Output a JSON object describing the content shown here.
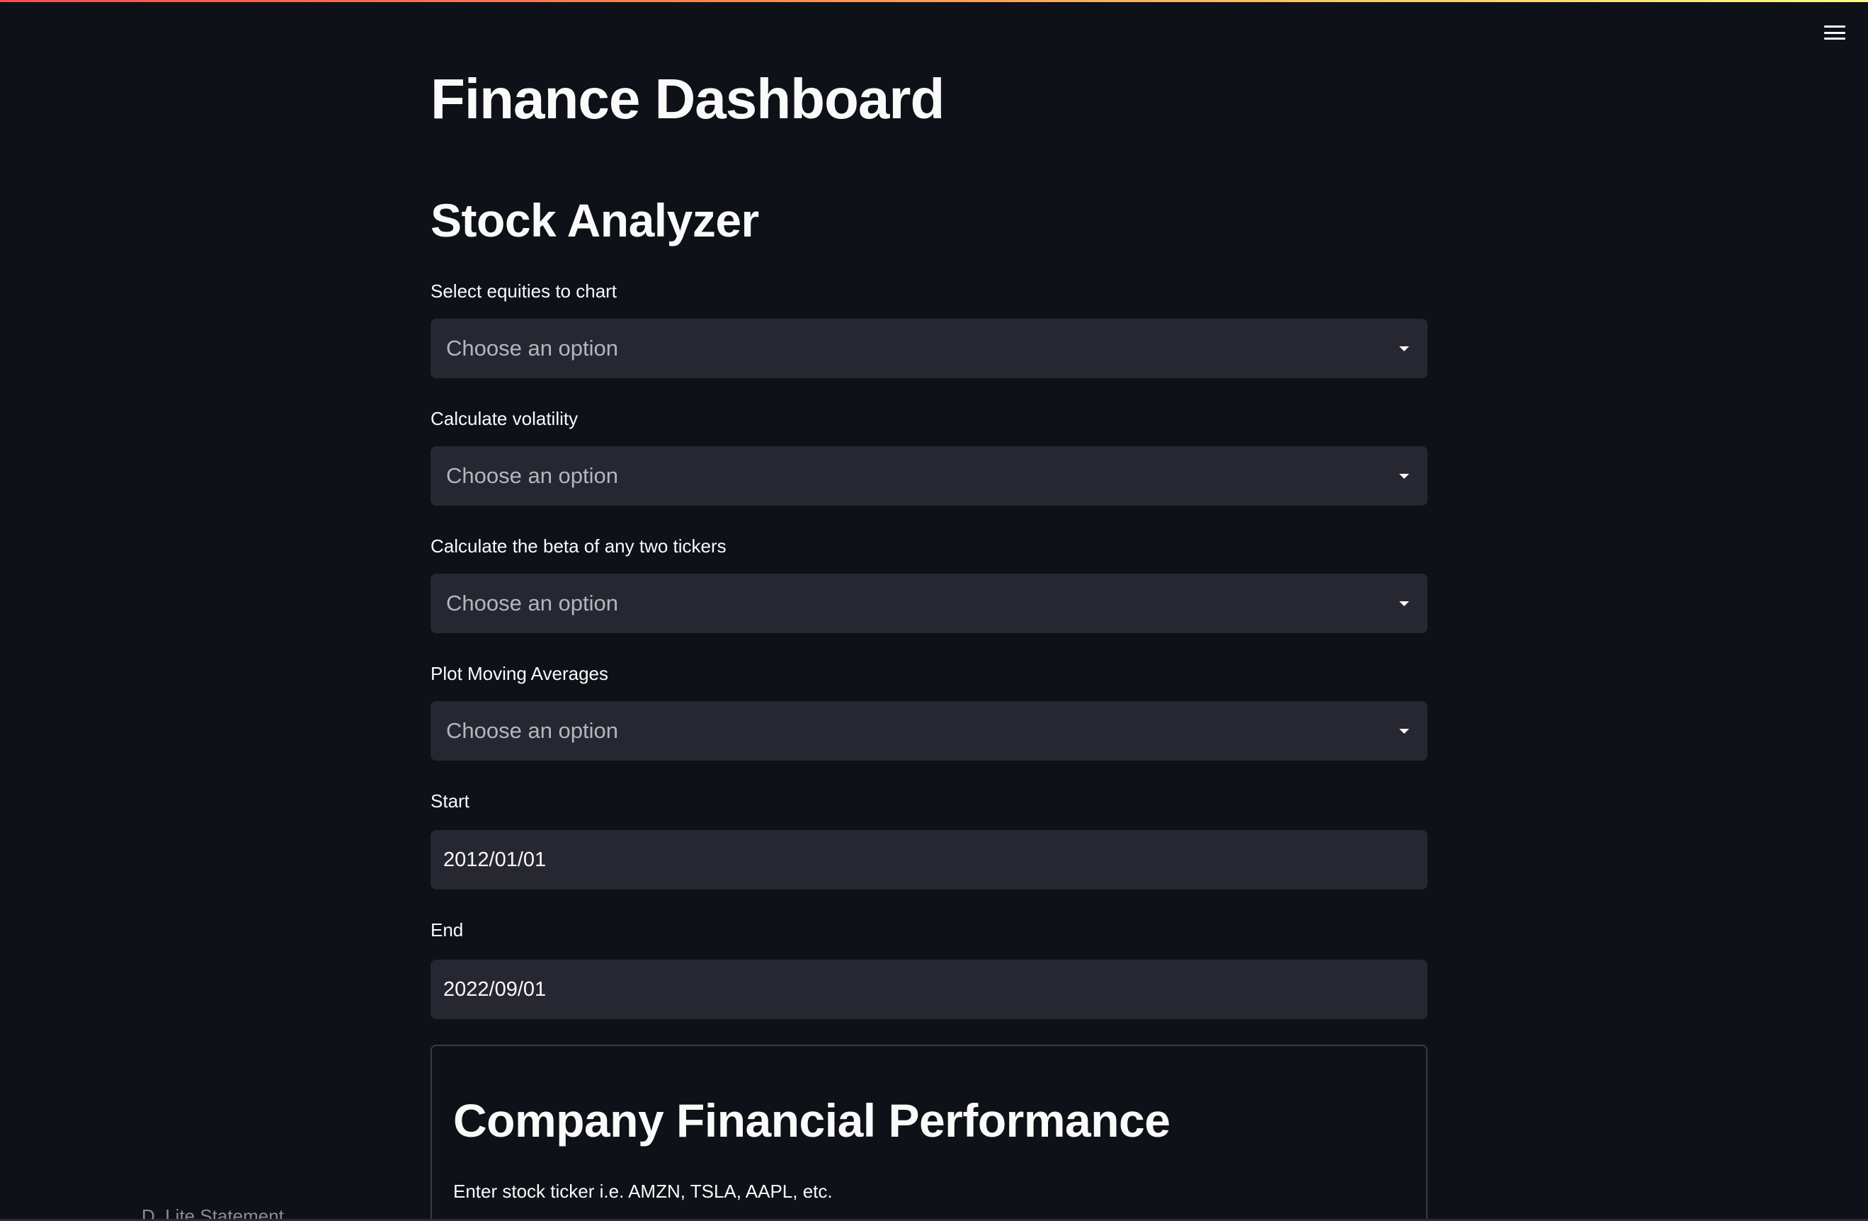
{
  "header": {
    "menu_icon": "hamburger-menu-icon",
    "accent_gradient": [
      "#ff4b4b",
      "#fffd80"
    ]
  },
  "main": {
    "title": "Finance Dashboard",
    "section_title": "Stock Analyzer",
    "fields": [
      {
        "label": "Select equities to chart",
        "placeholder": "Choose an option"
      },
      {
        "label": "Calculate volatility",
        "placeholder": "Choose an option"
      },
      {
        "label": "Calculate the beta of any two tickers",
        "placeholder": "Choose an option"
      },
      {
        "label": "Plot Moving Averages",
        "placeholder": "Choose an option"
      }
    ],
    "start": {
      "label": "Start",
      "value": "2012/01/01"
    },
    "end": {
      "label": "End",
      "value": "2022/09/01"
    }
  },
  "expander": {
    "title": "Company Financial Performance",
    "caption": "Enter stock ticker i.e. AMZN, TSLA, AAPL, etc."
  },
  "sidebar": {
    "peek_text": "D. Lite Statement"
  },
  "colors": {
    "background": "#0e1117",
    "input_background": "#262730",
    "text": "#fafafa",
    "placeholder": "#b4b6bd"
  }
}
